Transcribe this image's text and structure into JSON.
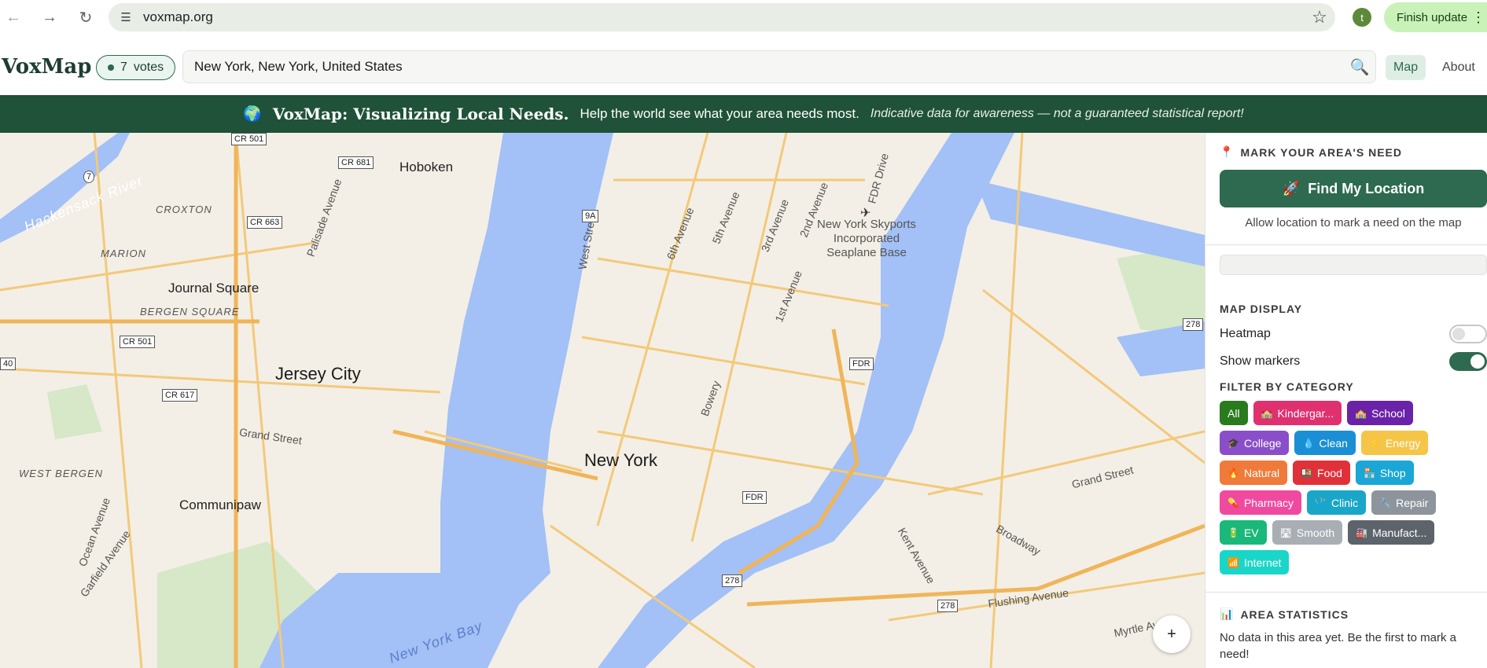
{
  "browser": {
    "url": "voxmap.org",
    "profile_initial": "t",
    "finish_update_label": "Finish update"
  },
  "header": {
    "logo": "VoxMap",
    "votes_count": "7",
    "votes_label": "votes",
    "search_value": "New York, New York, United States",
    "nav_map": "Map",
    "nav_about": "About"
  },
  "banner": {
    "title": "VoxMap: Visualizing Local Needs.",
    "subtitle": "Help the world see what your area needs most.",
    "note": "Indicative data for awareness — not a guaranteed statistical report!"
  },
  "map": {
    "labels": {
      "hoboken": "Hoboken",
      "jersey_city": "Jersey City",
      "journal_square": "Journal Square",
      "bergen_square": "BERGEN SQUARE",
      "marion": "MARION",
      "croxton": "CROXTON",
      "west_bergen": "WEST BERGEN",
      "communipaw": "Communipaw",
      "new_york": "New York",
      "seaplane": "New York Skyports Incorporated Seaplane Base",
      "hackensack": "Hackensack River",
      "new_york_bay": "New York Bay",
      "grand_street_left": "Grand Street",
      "grand_street_right": "Grand Street",
      "palisade": "Palisade Avenue",
      "ocean_ave": "Ocean Avenue",
      "garfield": "Garfield Avenue",
      "west_street": "West Street",
      "sixth_ave": "6th Avenue",
      "fifth_ave": "5th Avenue",
      "third_ave": "3rd Avenue",
      "second_ave": "2nd Avenue",
      "first_ave": "1st Avenue",
      "bowery": "Bowery",
      "fdr_drive": "FDR Drive",
      "broadway": "Broadway",
      "flushing": "Flushing Avenue",
      "kent": "Kent Avenue",
      "myrtle": "Myrtle Ave"
    },
    "shields": {
      "cr501_top": "CR 501",
      "cr681": "CR 681",
      "cr663": "CR 663",
      "cr501_mid": "CR 501",
      "cr617": "CR 617",
      "r7": "7",
      "r40": "40",
      "r9a": "9A",
      "fdr1": "FDR",
      "fdr2": "FDR",
      "i278_a": "278",
      "i278_b": "278",
      "i278_c": "278"
    },
    "zoom_in": "+"
  },
  "sidebar": {
    "mark_title": "MARK YOUR AREA'S NEED",
    "find_location": "Find My Location",
    "allow_note": "Allow location to mark a need on the map",
    "display_title": "MAP DISPLAY",
    "heatmap_label": "Heatmap",
    "heatmap_on": false,
    "markers_label": "Show markers",
    "markers_on": true,
    "filter_title": "FILTER BY CATEGORY",
    "categories": [
      {
        "label": "All",
        "icon": "",
        "color": "#2a7a1e"
      },
      {
        "label": "Kindergar...",
        "icon": "🏫",
        "color": "#e0306f"
      },
      {
        "label": "School",
        "icon": "🏫",
        "color": "#6a22a8"
      },
      {
        "label": "College",
        "icon": "🎓",
        "color": "#8a4fc8"
      },
      {
        "label": "Clean",
        "icon": "💧",
        "color": "#1a8fd6"
      },
      {
        "label": "Energy",
        "icon": "⚡",
        "color": "#f5c548"
      },
      {
        "label": "Natural",
        "icon": "🔥",
        "color": "#f07a3a"
      },
      {
        "label": "Food",
        "icon": "🍱",
        "color": "#e0313a"
      },
      {
        "label": "Shop",
        "icon": "🏪",
        "color": "#1aa6d6"
      },
      {
        "label": "Pharmacy",
        "icon": "💊",
        "color": "#f04aa0"
      },
      {
        "label": "Clinic",
        "icon": "🩺",
        "color": "#1aa6c8"
      },
      {
        "label": "Repair",
        "icon": "🔧",
        "color": "#8e949c"
      },
      {
        "label": "EV",
        "icon": "🔋",
        "color": "#1ab87a"
      },
      {
        "label": "Smooth",
        "icon": "🛣",
        "color": "#a8aeb4"
      },
      {
        "label": "Manufact...",
        "icon": "🏭",
        "color": "#5c636b"
      },
      {
        "label": "Internet",
        "icon": "📶",
        "color": "#1ad6c8"
      }
    ],
    "stats_title": "AREA STATISTICS",
    "stats_text": "No data in this area yet. Be the first to mark a need!"
  }
}
